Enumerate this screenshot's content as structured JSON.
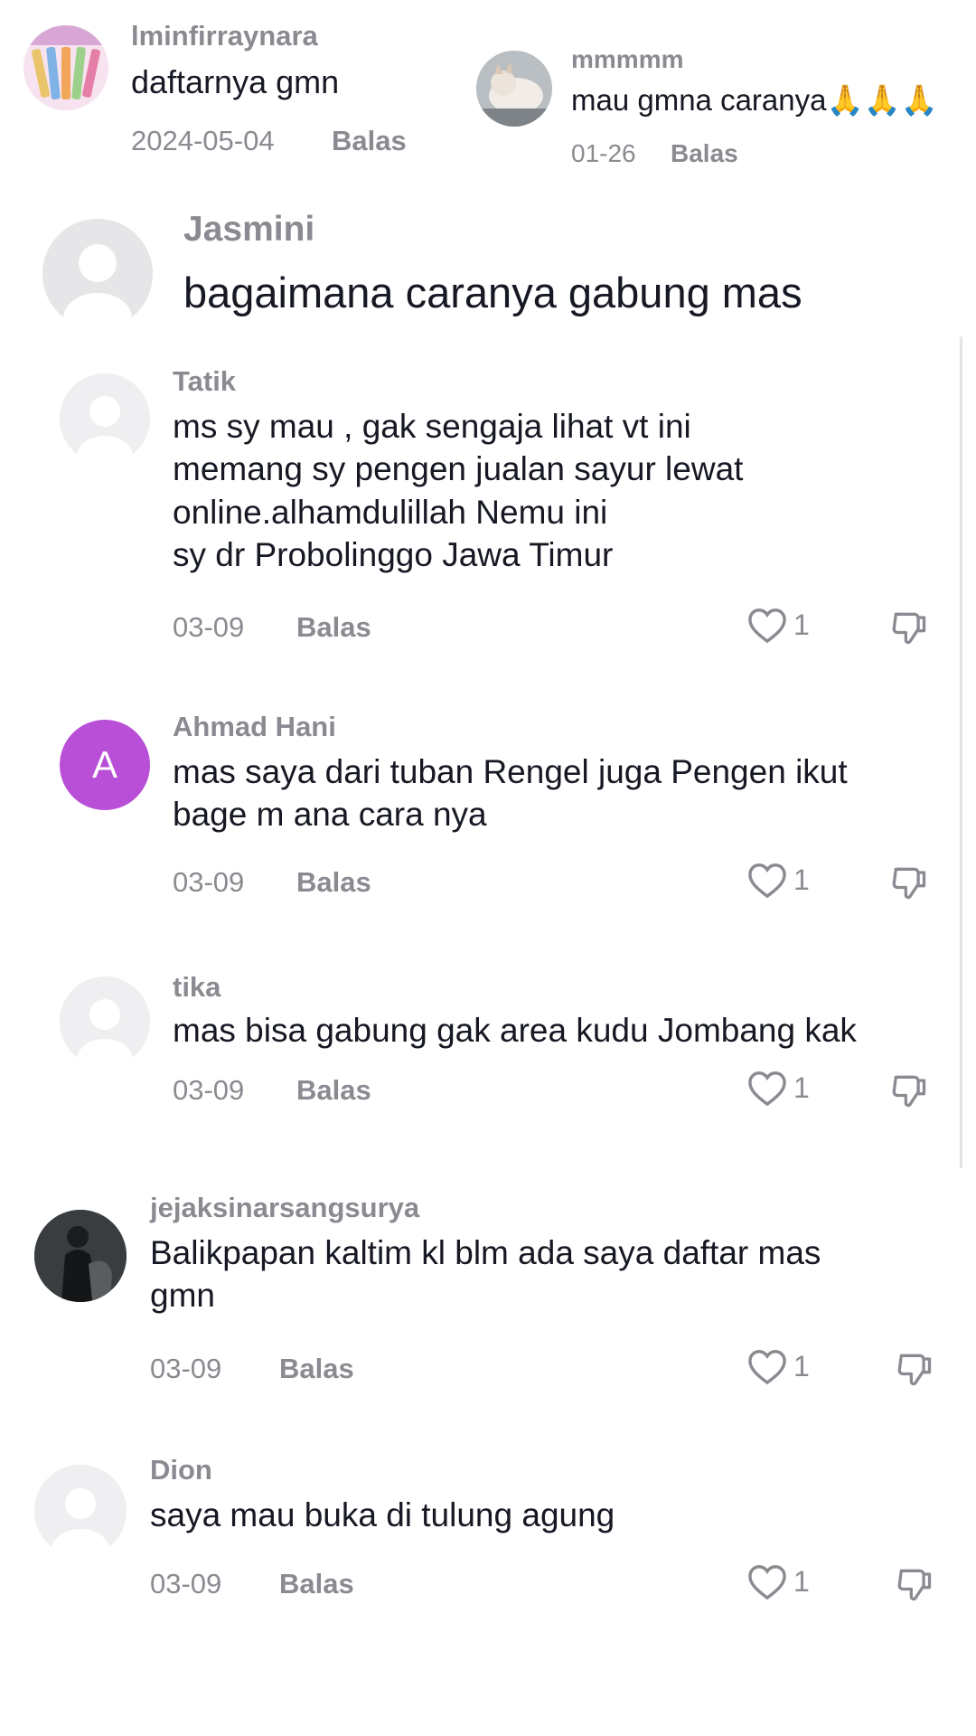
{
  "top_comments": [
    {
      "username": "lminfirraynara",
      "text": "daftarnya gmn",
      "date": "2024-05-04",
      "reply": "Balas",
      "avatar": "colorful-product-photo"
    },
    {
      "username": "mmmmm",
      "text": "mau gmna caranya🙏🙏🙏",
      "date": "01-26",
      "reply": "Balas",
      "avatar": "cat-photo"
    }
  ],
  "main_comment": {
    "username": "Jasmini",
    "text": "bagaimana caranya gabung mas",
    "avatar": "default-user-icon"
  },
  "replies": [
    {
      "username": "Tatik",
      "text": "ms sy mau , gak sengaja lihat vt ini\nmemang sy pengen jualan sayur lewat\nonline.alhamdulillah Nemu ini\nsy dr Probolinggo Jawa Timur",
      "date": "03-09",
      "reply": "Balas",
      "likes": "1",
      "avatar": "default-user-icon"
    },
    {
      "username": "Ahmad Hani",
      "text": "mas saya dari tuban Rengel juga Pengen ikut\nbage m ana cara nya",
      "date": "03-09",
      "reply": "Balas",
      "likes": "1",
      "avatar_letter": "A",
      "avatar_color": "#b84fd6"
    },
    {
      "username": "tika",
      "text": "mas bisa gabung gak area kudu Jombang kak",
      "date": "03-09",
      "reply": "Balas",
      "likes": "1",
      "avatar": "default-user-icon"
    }
  ],
  "bottom_comments": [
    {
      "username": "jejaksinarsangsurya",
      "text": "Balikpapan kaltim kl blm ada saya daftar mas\ngmn",
      "date": "03-09",
      "reply": "Balas",
      "likes": "1",
      "avatar": "dark-horse-photo"
    },
    {
      "username": "Dion",
      "text": "saya mau buka di tulung agung",
      "date": "03-09",
      "reply": "Balas",
      "likes": "1",
      "avatar": "default-user-icon"
    }
  ]
}
